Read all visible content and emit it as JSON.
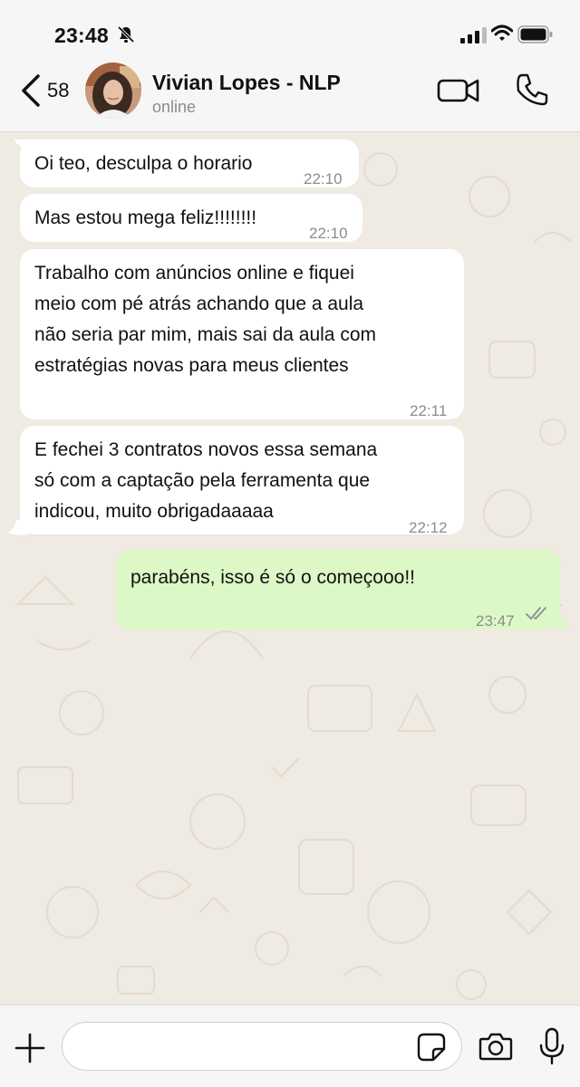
{
  "status_bar": {
    "time": "23:48"
  },
  "header": {
    "back_count": "58",
    "contact_name": "Vivian Lopes - NLP",
    "contact_status": "online"
  },
  "messages": [
    {
      "direction": "in",
      "text": "Oi teo, desculpa o horario",
      "time": "22:10"
    },
    {
      "direction": "in",
      "text": "Mas estou mega feliz!!!!!!!!",
      "time": "22:10"
    },
    {
      "direction": "in",
      "text": "Trabalho com anúncios online e fiquei\nmeio com pé atrás achando que a aula\nnão seria par mim, mais sai da aula com\nestratégias novas para meus clientes",
      "time": "22:11"
    },
    {
      "direction": "in",
      "text": "E fechei 3 contratos novos essa semana\nsó com a captação pela ferramenta que\nindicou, muito obrigadaaaaa",
      "time": "22:12"
    },
    {
      "direction": "out",
      "text": "parabéns, isso é só o começooo!!",
      "time": "23:47",
      "status": "read"
    }
  ],
  "composer": {
    "placeholder": ""
  },
  "icons": {
    "bell": "bell-slash-icon",
    "signal": "signal-icon",
    "wifi": "wifi-icon",
    "battery": "battery-icon",
    "back": "chevron-left-icon",
    "video": "video-camera-icon",
    "call": "phone-icon",
    "plus": "plus-icon",
    "sticker": "sticker-icon",
    "camera": "camera-icon",
    "mic": "microphone-icon",
    "read_receipt": "double-check-icon"
  },
  "colors": {
    "incoming_bubble": "#ffffff",
    "outgoing_bubble": "#dcf8c6",
    "chat_background": "#efeae2",
    "bar_background": "#f6f6f6",
    "timestamp": "#8c8c8c"
  }
}
